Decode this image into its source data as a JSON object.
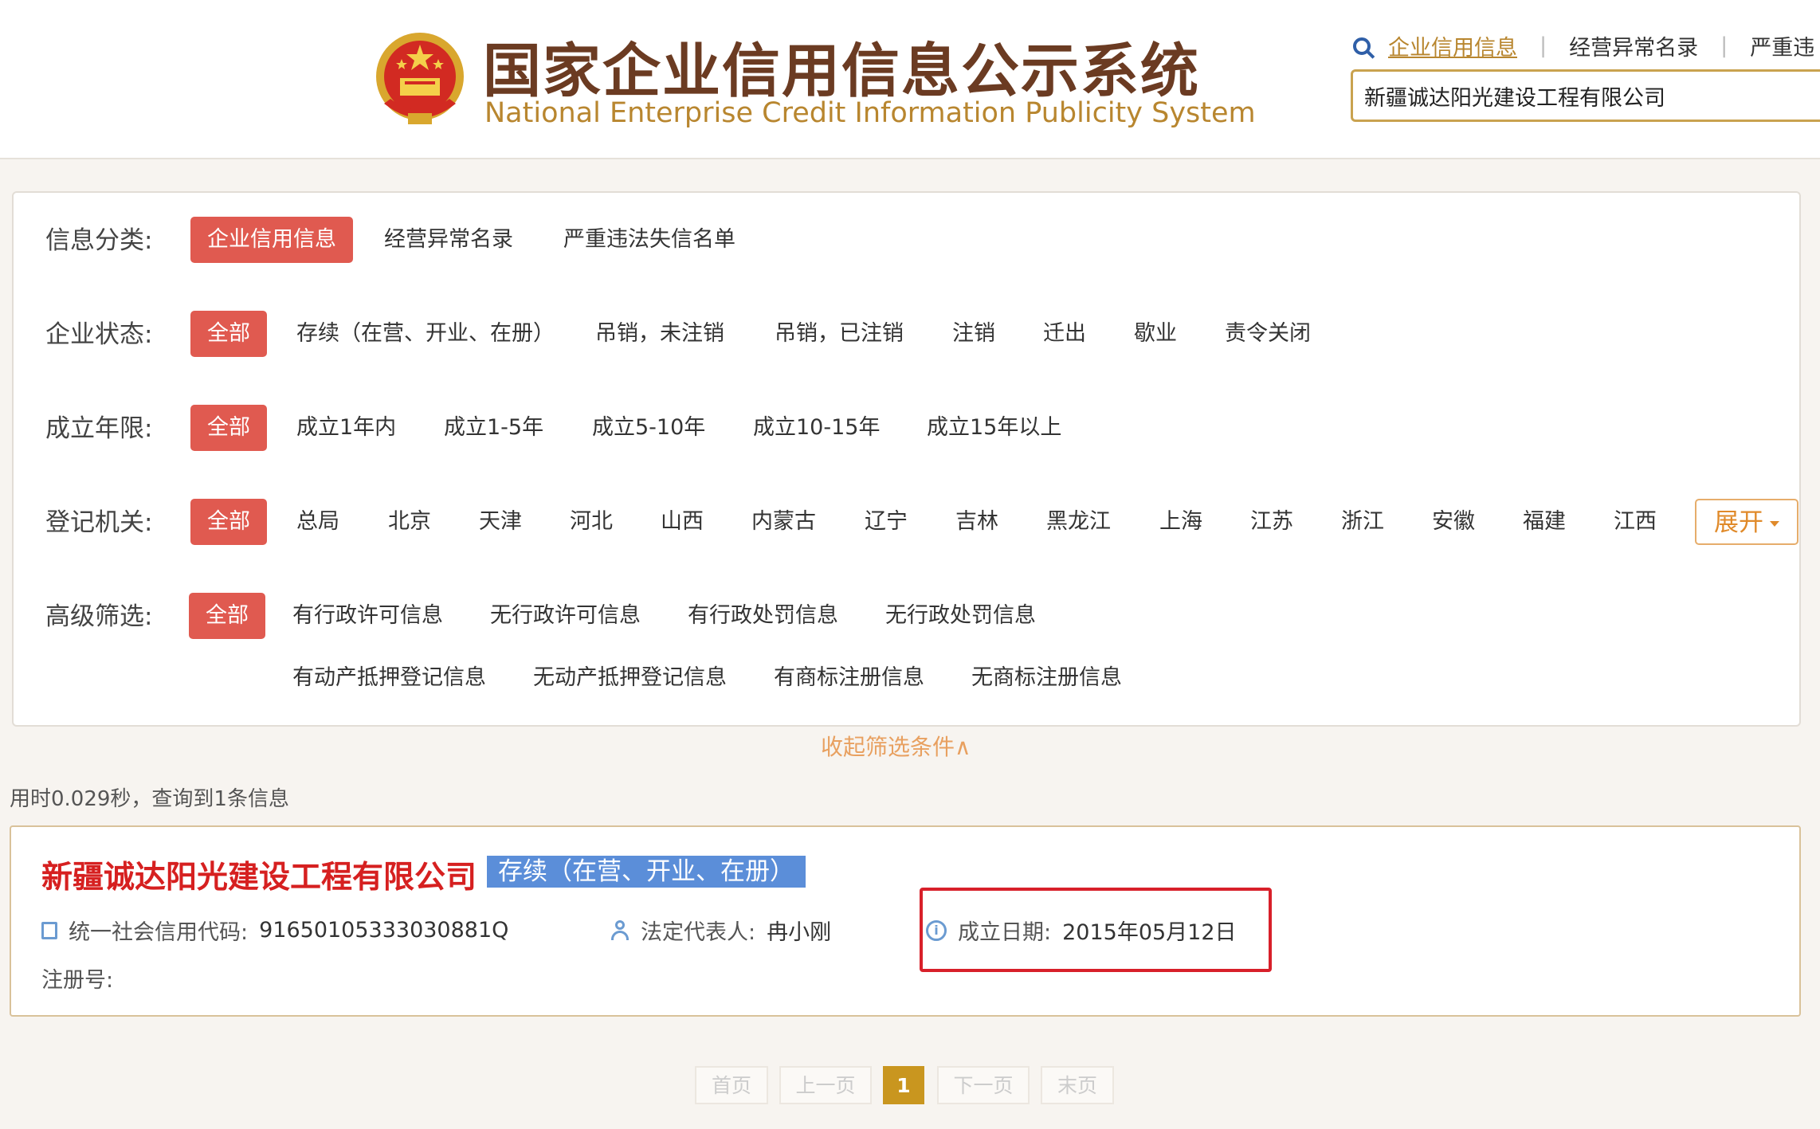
{
  "header": {
    "title_cn": "国家企业信用信息公示系统",
    "title_en": "National Enterprise Credit Information Publicity System",
    "nav": [
      "企业信用信息",
      "经营异常名录",
      "严重违"
    ],
    "search_value": "新疆诚达阳光建设工程有限公司"
  },
  "filters": {
    "category": {
      "label": "信息分类:",
      "options": [
        "企业信用信息",
        "经营异常名录",
        "严重违法失信名单"
      ]
    },
    "status": {
      "label": "企业状态:",
      "options": [
        "全部",
        "存续（在营、开业、在册）",
        "吊销，未注销",
        "吊销，已注销",
        "注销",
        "迁出",
        "歇业",
        "责令关闭"
      ]
    },
    "age": {
      "label": "成立年限:",
      "options": [
        "全部",
        "成立1年内",
        "成立1-5年",
        "成立5-10年",
        "成立10-15年",
        "成立15年以上"
      ]
    },
    "authority": {
      "label": "登记机关:",
      "options": [
        "全部",
        "总局",
        "北京",
        "天津",
        "河北",
        "山西",
        "内蒙古",
        "辽宁",
        "吉林",
        "黑龙江",
        "上海",
        "江苏",
        "浙江",
        "安徽",
        "福建",
        "江西"
      ],
      "expand": "展开"
    },
    "advanced": {
      "label": "高级筛选:",
      "options": [
        "全部",
        "有行政许可信息",
        "无行政许可信息",
        "有行政处罚信息",
        "无行政处罚信息"
      ],
      "options_row2": [
        "有动产抵押登记信息",
        "无动产抵押登记信息",
        "有商标注册信息",
        "无商标注册信息"
      ]
    },
    "collapse": "收起筛选条件∧"
  },
  "result_info": "用时0.029秒，查询到1条信息",
  "result": {
    "company": "新疆诚达阳光建设工程有限公司",
    "status": "存续（在营、开业、在册）",
    "credit_code_label": "统一社会信用代码:",
    "credit_code": "91650105333030881Q",
    "legal_rep_label": "法定代表人:",
    "legal_rep": "冉小刚",
    "date_label": "成立日期:",
    "date": "2015年05月12日",
    "reg_no_label": "注册号:"
  },
  "pagination": [
    "首页",
    "上一页",
    "1",
    "下一页",
    "末页"
  ],
  "colors": {
    "active_tag": "#e05a50",
    "company": "#d62020",
    "badge": "#5b8ed9",
    "gold": "#c9961f",
    "highlight": "#d8202a"
  }
}
